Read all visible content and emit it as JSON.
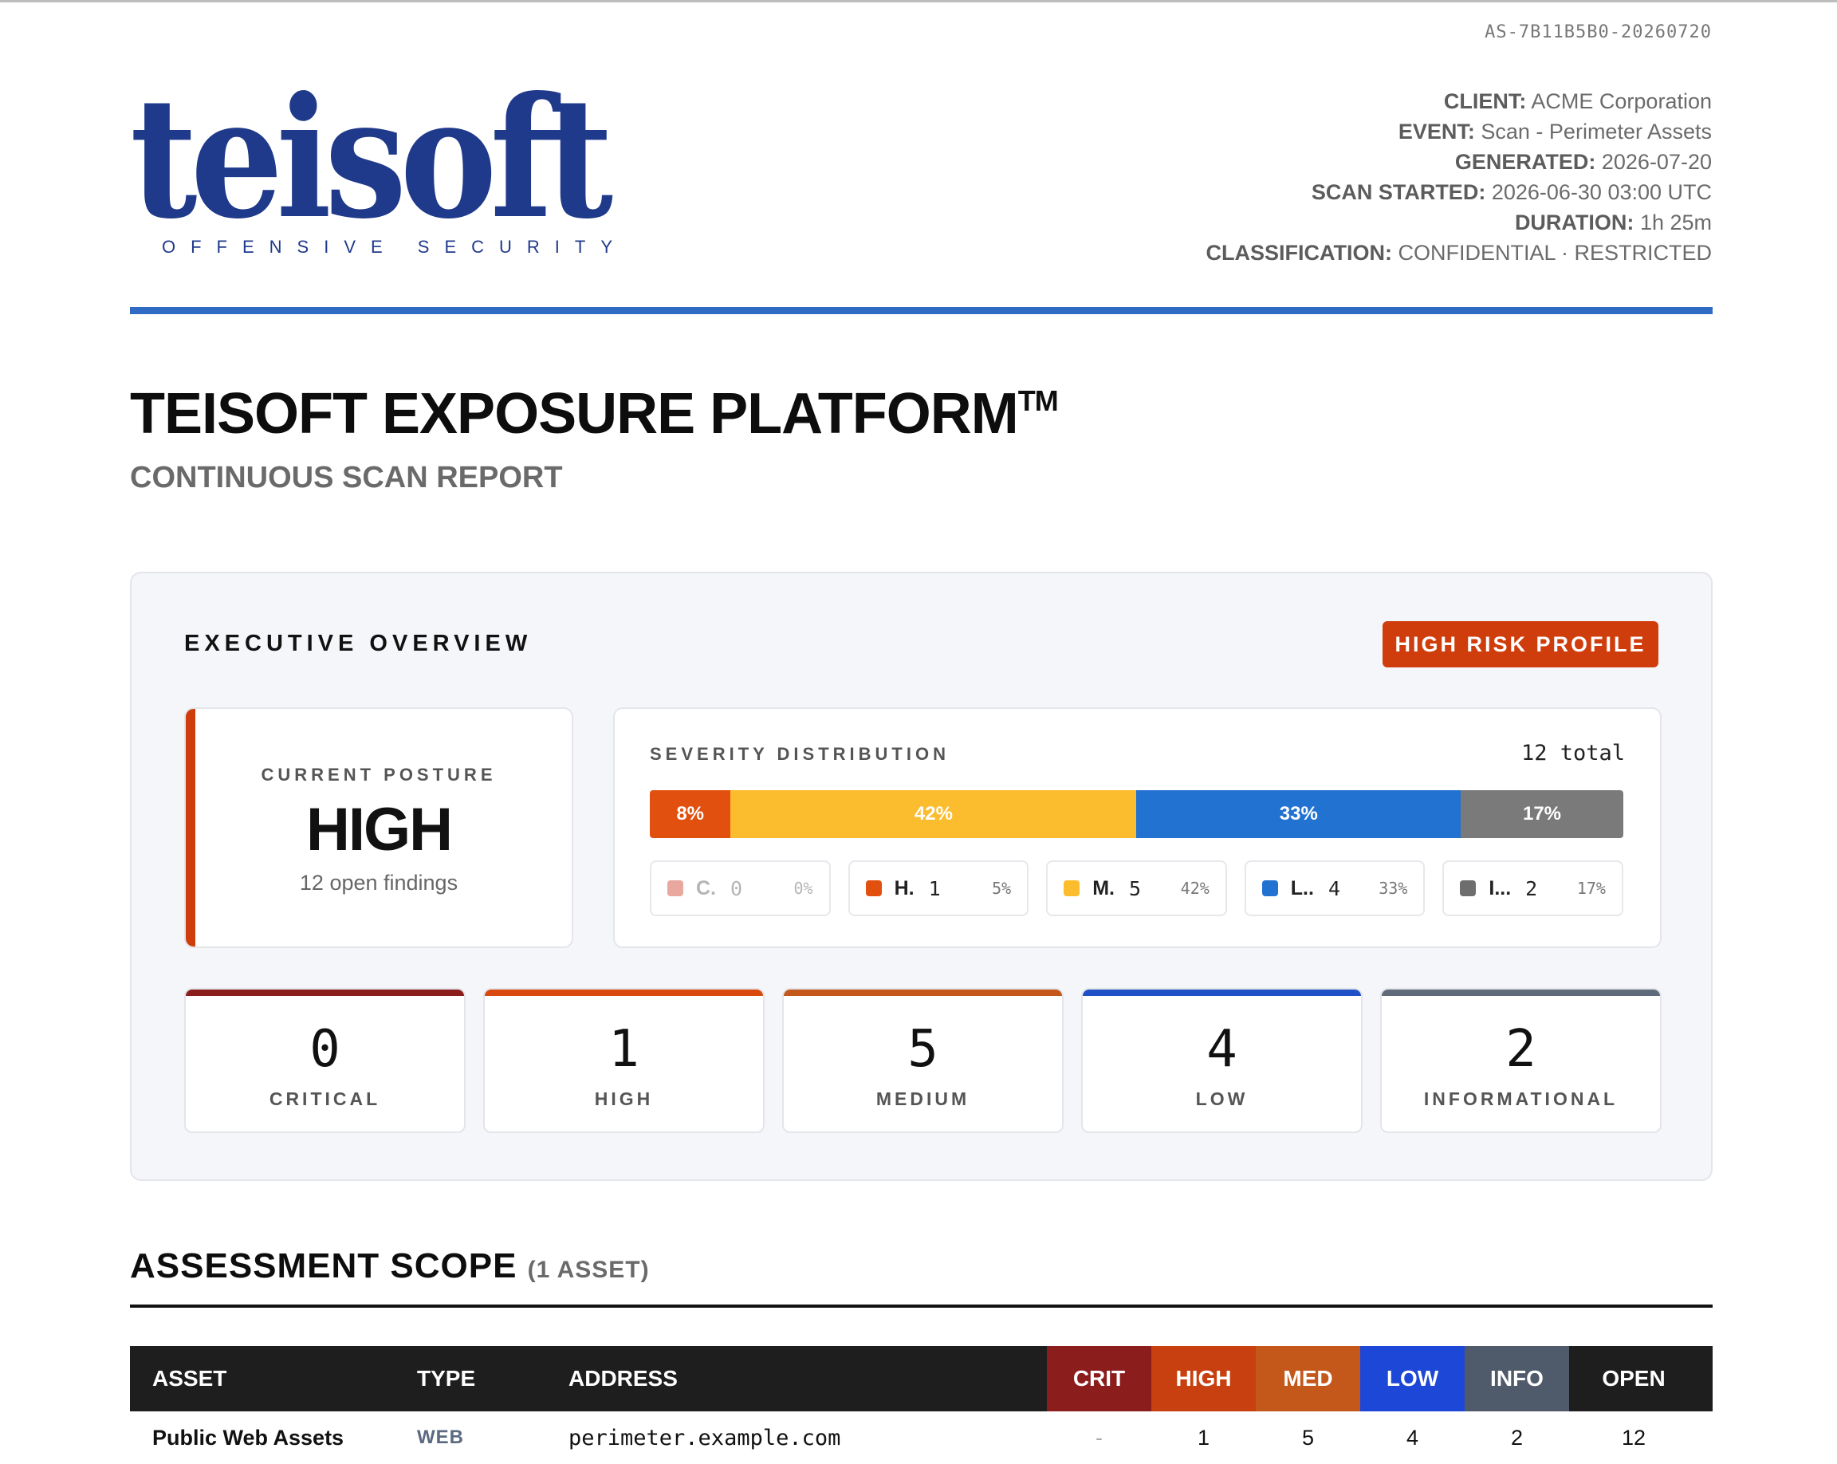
{
  "doc_id": "AS-7B11B5B0-20260720",
  "logo": {
    "word": "teisoft",
    "tagline": "OFFENSIVE SECURITY"
  },
  "meta": [
    {
      "key": "CLIENT:",
      "value": "ACME Corporation"
    },
    {
      "key": "EVENT:",
      "value": "Scan - Perimeter Assets"
    },
    {
      "key": "GENERATED:",
      "value": "2026-07-20"
    },
    {
      "key": "SCAN STARTED:",
      "value": "2026-06-30 03:00 UTC"
    },
    {
      "key": "DURATION:",
      "value": "1h 25m"
    },
    {
      "key": "CLASSIFICATION:",
      "value": "CONFIDENTIAL · RESTRICTED"
    }
  ],
  "title": "TEISOFT EXPOSURE PLATFORM",
  "title_mark": "TM",
  "subtitle": "CONTINUOUS SCAN REPORT",
  "overview": {
    "title": "EXECUTIVE OVERVIEW",
    "risk_badge": "HIGH RISK PROFILE",
    "posture": {
      "label": "CURRENT POSTURE",
      "value": "HIGH",
      "sub": "12 open findings"
    },
    "distribution": {
      "label": "SEVERITY DISTRIBUTION",
      "total": "12 total",
      "segments": [
        {
          "label": "8%",
          "fraction": 0.083,
          "color": "#e2500f"
        },
        {
          "label": "42%",
          "fraction": 0.417,
          "color": "#fbbc2e"
        },
        {
          "label": "33%",
          "fraction": 0.333,
          "color": "#2272d2"
        },
        {
          "label": "17%",
          "fraction": 0.167,
          "color": "#7a7a7a"
        }
      ],
      "chips": [
        {
          "name": "C.",
          "count": "0",
          "pct": "0%",
          "color": "#e8a8a0",
          "dim": true
        },
        {
          "name": "H.",
          "count": "1",
          "pct": "5%",
          "color": "#e2500f",
          "dim": false
        },
        {
          "name": "M.",
          "count": "5",
          "pct": "42%",
          "color": "#fbbc2e",
          "dim": false
        },
        {
          "name": "L..",
          "count": "4",
          "pct": "33%",
          "color": "#2272d2",
          "dim": false
        },
        {
          "name": "I...",
          "count": "2",
          "pct": "17%",
          "color": "#6e6e6e",
          "dim": false
        }
      ]
    },
    "counters": [
      {
        "value": "0",
        "label": "CRITICAL",
        "color": "#8b1d1d"
      },
      {
        "value": "1",
        "label": "HIGH",
        "color": "#d9480f"
      },
      {
        "value": "5",
        "label": "MEDIUM",
        "color": "#c4571a"
      },
      {
        "value": "4",
        "label": "LOW",
        "color": "#2050c8"
      },
      {
        "value": "2",
        "label": "INFORMATIONAL",
        "color": "#5f6b7a"
      }
    ]
  },
  "scope": {
    "title": "ASSESSMENT SCOPE",
    "count": "(1 ASSET)",
    "columns": [
      {
        "label": "ASSET",
        "bg": "#1e1e1e"
      },
      {
        "label": "TYPE",
        "bg": "#1e1e1e"
      },
      {
        "label": "ADDRESS",
        "bg": "#1e1e1e"
      },
      {
        "label": "CRIT",
        "bg": "#8b1d1d"
      },
      {
        "label": "HIGH",
        "bg": "#c8400f"
      },
      {
        "label": "MED",
        "bg": "#c4571a"
      },
      {
        "label": "LOW",
        "bg": "#1d47d6"
      },
      {
        "label": "INFO",
        "bg": "#4f5b6a"
      },
      {
        "label": "OPEN",
        "bg": "#1e1e1e"
      }
    ],
    "rows": [
      {
        "asset": "Public Web Assets",
        "type": "WEB",
        "address": "perimeter.example.com",
        "crit": "-",
        "high": "1",
        "med": "5",
        "low": "4",
        "info": "2",
        "open": "12"
      }
    ]
  }
}
